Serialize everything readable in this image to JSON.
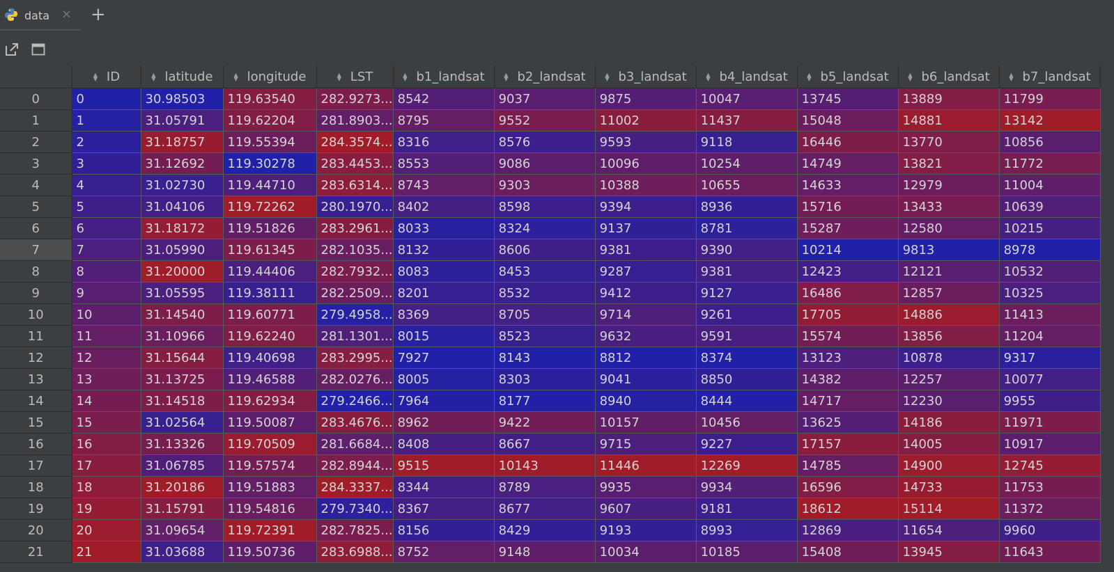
{
  "tab": {
    "title": "data",
    "close": "×",
    "add": "+"
  },
  "toolbar": {
    "open_external_icon": "open-external-icon",
    "maximize_icon": "maximize-icon"
  },
  "columns": [
    "ID",
    "latitude",
    "longitude",
    "LST",
    "b1_landsat",
    "b2_landsat",
    "b3_landsat",
    "b4_landsat",
    "b5_landsat",
    "b6_landsat",
    "b7_landsat"
  ],
  "rows": [
    [
      "0",
      "0",
      "30.98503",
      "119.63540",
      "282.9273...",
      "8542",
      "9037",
      "9875",
      "10047",
      "13745",
      "13889",
      "11799"
    ],
    [
      "1",
      "1",
      "31.05791",
      "119.62204",
      "281.8903...",
      "8795",
      "9552",
      "11002",
      "11437",
      "15048",
      "14881",
      "13142"
    ],
    [
      "2",
      "2",
      "31.18757",
      "119.55394",
      "284.3574...",
      "8316",
      "8576",
      "9593",
      "9118",
      "16446",
      "13770",
      "10856"
    ],
    [
      "3",
      "3",
      "31.12692",
      "119.30278",
      "283.4453...",
      "8553",
      "9086",
      "10096",
      "10254",
      "14749",
      "13821",
      "11772"
    ],
    [
      "4",
      "4",
      "31.02730",
      "119.44710",
      "283.6314...",
      "8743",
      "9303",
      "10388",
      "10655",
      "14633",
      "12979",
      "11004"
    ],
    [
      "5",
      "5",
      "31.04106",
      "119.72262",
      "280.1970...",
      "8402",
      "8598",
      "9394",
      "8936",
      "15716",
      "13433",
      "10639"
    ],
    [
      "6",
      "6",
      "31.18172",
      "119.51826",
      "283.2961...",
      "8033",
      "8324",
      "9137",
      "8781",
      "15287",
      "12580",
      "10215"
    ],
    [
      "7",
      "7",
      "31.05990",
      "119.61345",
      "282.1035...",
      "8132",
      "8606",
      "9381",
      "9390",
      "10214",
      "9813",
      "8978"
    ],
    [
      "8",
      "8",
      "31.20000",
      "119.44406",
      "282.7932...",
      "8083",
      "8453",
      "9287",
      "9381",
      "12423",
      "12121",
      "10532"
    ],
    [
      "9",
      "9",
      "31.05595",
      "119.38111",
      "282.2509...",
      "8201",
      "8532",
      "9412",
      "9127",
      "16486",
      "12857",
      "10325"
    ],
    [
      "10",
      "10",
      "31.14540",
      "119.60771",
      "279.4958...",
      "8369",
      "8705",
      "9714",
      "9261",
      "17705",
      "14886",
      "11413"
    ],
    [
      "11",
      "11",
      "31.10966",
      "119.62240",
      "281.1301...",
      "8015",
      "8523",
      "9632",
      "9591",
      "15574",
      "13856",
      "11204"
    ],
    [
      "12",
      "12",
      "31.15644",
      "119.40698",
      "283.2995...",
      "7927",
      "8143",
      "8812",
      "8374",
      "13123",
      "10878",
      "9317"
    ],
    [
      "13",
      "13",
      "31.13725",
      "119.46588",
      "282.0276...",
      "8005",
      "8303",
      "9041",
      "8850",
      "14382",
      "12257",
      "10077"
    ],
    [
      "14",
      "14",
      "31.14518",
      "119.62934",
      "279.2466...",
      "7964",
      "8177",
      "8940",
      "8444",
      "14717",
      "12230",
      "9955"
    ],
    [
      "15",
      "15",
      "31.02564",
      "119.50087",
      "283.4676...",
      "8962",
      "9422",
      "10157",
      "10456",
      "13625",
      "14186",
      "11971"
    ],
    [
      "16",
      "16",
      "31.13326",
      "119.70509",
      "281.6684...",
      "8408",
      "8667",
      "9715",
      "9227",
      "17157",
      "14005",
      "10917"
    ],
    [
      "17",
      "17",
      "31.06785",
      "119.57574",
      "282.8944...",
      "9515",
      "10143",
      "11446",
      "12269",
      "14785",
      "14900",
      "12745"
    ],
    [
      "18",
      "18",
      "31.20186",
      "119.51883",
      "284.3337...",
      "8344",
      "8789",
      "9935",
      "9934",
      "16596",
      "14733",
      "11753"
    ],
    [
      "19",
      "19",
      "31.15791",
      "119.54816",
      "279.7340...",
      "8367",
      "8677",
      "9607",
      "9181",
      "18612",
      "15114",
      "11372"
    ],
    [
      "20",
      "20",
      "31.09654",
      "119.72391",
      "282.7825...",
      "8156",
      "8429",
      "9193",
      "8993",
      "12869",
      "11654",
      "9960"
    ],
    [
      "21",
      "21",
      "31.03688",
      "119.50736",
      "283.6988...",
      "8752",
      "9148",
      "10034",
      "10185",
      "15408",
      "13945",
      "11643"
    ]
  ],
  "selected_row": 7,
  "colors": {
    "low": "#2020a8",
    "high": "#a01c28",
    "background": "#3c3f41"
  }
}
